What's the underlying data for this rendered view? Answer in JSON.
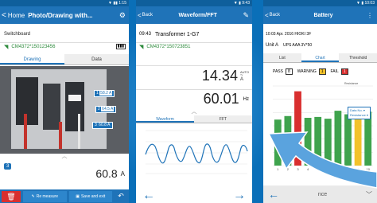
{
  "colors": {
    "background": "#0a6fb8",
    "header": "#1f73b8",
    "arrow": "#5aa3de",
    "pass_bar": "#3fa34d",
    "fail_bar": "#d92f2f",
    "warning_bar": "#f3c22b"
  },
  "phone1": {
    "back_label": "Home",
    "title": "Photo/Drawing with...",
    "settings_icon": "gear-icon",
    "section_title": "Switchboard",
    "device_id": "CM4372*150123456",
    "battery_icon": "battery-icon",
    "tabs": [
      "Drawing",
      "Data"
    ],
    "markers": [
      {
        "num": "1",
        "value": "58.2 A"
      },
      {
        "num": "2",
        "value": "64.5 A"
      },
      {
        "num": "3",
        "value": "60.8 A"
      }
    ],
    "selected_marker": "3",
    "reading_value": "60.8",
    "reading_unit": "A",
    "bottom_buttons": [
      "",
      "Re measure",
      "Save and exit",
      ""
    ]
  },
  "phone2": {
    "back_label": "Back",
    "title": "Waveform/FFT",
    "edit_icon": "pencil-icon",
    "time": "09:43",
    "name": "Transformer 1-G7",
    "device_id": "CM4372*150723851",
    "reading1_value": "14.34",
    "reading1_unit_top": "AUTO",
    "reading1_unit_sym": "~",
    "reading1_unit": "A",
    "reading2_value": "60.01",
    "reading2_unit": "Hz",
    "tabs": [
      "Waveform",
      "FFT"
    ],
    "left_arrow": "←",
    "right_arrow": "→"
  },
  "phone3": {
    "back_label": "Back",
    "title": "Battery",
    "datetime": "10:03  Apr. 2016 HIOKI 3F",
    "unit_label": "Unit  A",
    "unit_value": "UPS AAA 3V*50",
    "tabs": [
      "List",
      "Chart",
      "Threshold"
    ],
    "pass_label": "PASS",
    "pass_count": "8",
    "warning_label": "WARNING",
    "warning_count": "1",
    "fail_label": "FAIL",
    "fail_count": "1",
    "legend_title": "Resistance",
    "legend_items": [
      "Data No. ▾",
      "Resistance ▾"
    ],
    "x_ticks": [
      "1",
      "2",
      "3",
      "4",
      "5",
      "6",
      "7",
      "8",
      "9",
      "10"
    ],
    "bottom_text": "nce"
  },
  "chart_data": {
    "type": "bar",
    "categories": [
      "1",
      "2",
      "3",
      "4",
      "5",
      "6",
      "7",
      "8",
      "9",
      "10"
    ],
    "values": [
      5.2,
      5.6,
      8.4,
      5.4,
      5.5,
      5.3,
      6.2,
      5.8,
      6.3,
      6.1
    ],
    "ylim": [
      0,
      9
    ]
  }
}
